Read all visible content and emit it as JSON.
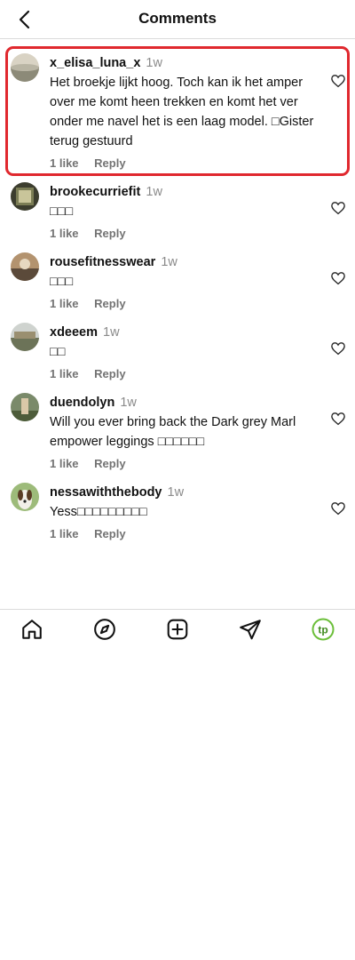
{
  "header": {
    "title": "Comments",
    "back_icon": "chevron-left-icon"
  },
  "colors": {
    "highlight": "#e0282e",
    "muted": "#737373",
    "accent_logo": "#6cbf3a"
  },
  "comments": [
    {
      "user": "x_elisa_luna_x",
      "time": "1w",
      "text": "Het broekje lijkt hoog. Toch kan ik het amper over me komt heen trekken en komt het ver onder me navel het is een laag model. □Gister terug gestuurd",
      "likes": "1 like",
      "reply": "Reply",
      "highlighted": true
    },
    {
      "user": "brookecurriefit",
      "time": "1w",
      "text": "□□□",
      "likes": "1 like",
      "reply": "Reply"
    },
    {
      "user": "rousefitnesswear",
      "time": "1w",
      "text": "□□□",
      "likes": "1 like",
      "reply": "Reply"
    },
    {
      "user": "xdeeem",
      "time": "1w",
      "text": "□□",
      "likes": "1 like",
      "reply": "Reply"
    },
    {
      "user": "duendolyn",
      "time": "1w",
      "text": "Will you ever bring back the Dark grey Marl empower leggings □□□□□□",
      "likes": "1 like",
      "reply": "Reply"
    },
    {
      "user": "nessawiththebody",
      "time": "1w",
      "text": "Yess□□□□□□□□□",
      "likes": "1 like",
      "reply": "Reply"
    }
  ],
  "tabbar": {
    "items": [
      "home-icon",
      "explore-compass-icon",
      "create-plus-icon",
      "direct-send-icon",
      "profile-logo-icon"
    ],
    "profile_logo_text": "tp"
  }
}
